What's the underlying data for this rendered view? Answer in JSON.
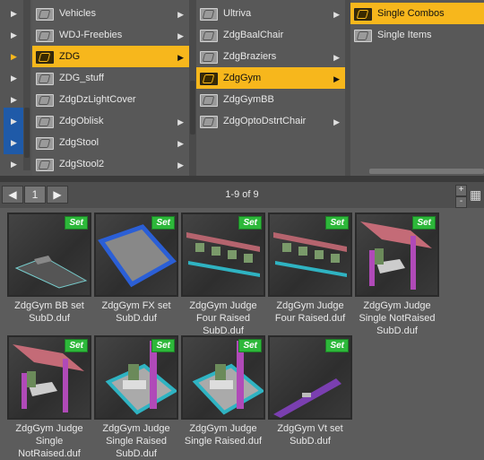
{
  "columns": [
    {
      "items": [
        {
          "label": "Vehicles",
          "selected": false,
          "arrow": true
        },
        {
          "label": "WDJ-Freebies",
          "selected": false,
          "arrow": true
        },
        {
          "label": "ZDG",
          "selected": true,
          "arrow": true
        },
        {
          "label": "ZDG_stuff",
          "selected": false,
          "arrow": false
        },
        {
          "label": "ZdgDzLightCover",
          "selected": false,
          "arrow": false
        },
        {
          "label": "ZdgOblisk",
          "selected": false,
          "arrow": true
        },
        {
          "label": "ZdgStool",
          "selected": false,
          "arrow": true
        },
        {
          "label": "ZdgStool2",
          "selected": false,
          "arrow": true
        }
      ]
    },
    {
      "items": [
        {
          "label": "Ultriva",
          "selected": false,
          "arrow": true
        },
        {
          "label": "ZdgBaalChair",
          "selected": false,
          "arrow": false
        },
        {
          "label": "ZdgBraziers",
          "selected": false,
          "arrow": true
        },
        {
          "label": "ZdgGym",
          "selected": true,
          "arrow": true
        },
        {
          "label": "ZdgGymBB",
          "selected": false,
          "arrow": false
        },
        {
          "label": "ZdgOptoDstrtChair",
          "selected": false,
          "arrow": true
        }
      ]
    },
    {
      "items": [
        {
          "label": "Single Combos",
          "selected": true,
          "arrow": false
        },
        {
          "label": "Single Items",
          "selected": false,
          "arrow": false
        }
      ]
    }
  ],
  "toolbar": {
    "back": "◀",
    "page": "1",
    "forward": "▶",
    "count": "1-9 of 9",
    "zoom_in": "+",
    "zoom_out": "-",
    "grid_view": "▦"
  },
  "badge_text": "Set",
  "assets": [
    {
      "lines": [
        "ZdgGym BB set",
        "SubD.duf"
      ],
      "kind": "bb"
    },
    {
      "lines": [
        "ZdgGym FX set",
        "SubD.duf"
      ],
      "kind": "fx"
    },
    {
      "lines": [
        "ZdgGym Judge",
        "Four Raised",
        "SubD.duf"
      ],
      "kind": "four"
    },
    {
      "lines": [
        "ZdgGym Judge",
        "Four Raised.duf"
      ],
      "kind": "four"
    },
    {
      "lines": [
        "ZdgGym Judge",
        "Single NotRaised",
        "SubD.duf"
      ],
      "kind": "single"
    },
    {
      "lines": [
        "ZdgGym Judge",
        "Single",
        "NotRaised.duf"
      ],
      "kind": "single"
    },
    {
      "lines": [
        "ZdgGym Judge",
        "Single Raised",
        "SubD.duf"
      ],
      "kind": "raised"
    },
    {
      "lines": [
        "ZdgGym Judge",
        "Single Raised.duf"
      ],
      "kind": "raised"
    },
    {
      "lines": [
        "ZdgGym Vt set",
        "SubD.duf"
      ],
      "kind": "vt"
    }
  ],
  "colors": {
    "selected": "#f7b71c",
    "badge": "#2db83a"
  }
}
